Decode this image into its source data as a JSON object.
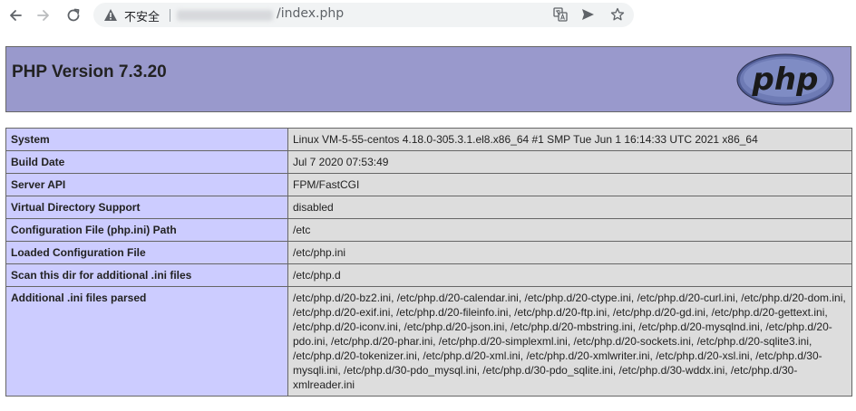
{
  "browser": {
    "security_label": "不安全",
    "url_path": "/index.php"
  },
  "header": {
    "title": "PHP Version 7.3.20",
    "logo_text": "php"
  },
  "info_rows": [
    {
      "key": "System",
      "value": "Linux VM-5-55-centos 4.18.0-305.3.1.el8.x86_64 #1 SMP Tue Jun 1 16:14:33 UTC 2021 x86_64"
    },
    {
      "key": "Build Date",
      "value": "Jul 7 2020 07:53:49"
    },
    {
      "key": "Server API",
      "value": "FPM/FastCGI"
    },
    {
      "key": "Virtual Directory Support",
      "value": "disabled"
    },
    {
      "key": "Configuration File (php.ini) Path",
      "value": "/etc"
    },
    {
      "key": "Loaded Configuration File",
      "value": "/etc/php.ini"
    },
    {
      "key": "Scan this dir for additional .ini files",
      "value": "/etc/php.d"
    },
    {
      "key": "Additional .ini files parsed",
      "value": "/etc/php.d/20-bz2.ini, /etc/php.d/20-calendar.ini, /etc/php.d/20-ctype.ini, /etc/php.d/20-curl.ini, /etc/php.d/20-dom.ini, /etc/php.d/20-exif.ini, /etc/php.d/20-fileinfo.ini, /etc/php.d/20-ftp.ini, /etc/php.d/20-gd.ini, /etc/php.d/20-gettext.ini, /etc/php.d/20-iconv.ini, /etc/php.d/20-json.ini, /etc/php.d/20-mbstring.ini, /etc/php.d/20-mysqlnd.ini, /etc/php.d/20-pdo.ini, /etc/php.d/20-phar.ini, /etc/php.d/20-simplexml.ini, /etc/php.d/20-sockets.ini, /etc/php.d/20-sqlite3.ini, /etc/php.d/20-tokenizer.ini, /etc/php.d/20-xml.ini, /etc/php.d/20-xmlwriter.ini, /etc/php.d/20-xsl.ini, /etc/php.d/30-mysqli.ini, /etc/php.d/30-pdo_mysql.ini, /etc/php.d/30-pdo_sqlite.ini, /etc/php.d/30-wddx.ini, /etc/php.d/30-xmlreader.ini"
    }
  ],
  "colors": {
    "header_bg": "#9999cc",
    "key_bg": "#ccccff",
    "value_bg": "#dddddd",
    "border": "#666666"
  },
  "icons": {
    "back": "arrow-left-icon",
    "forward": "arrow-right-icon",
    "reload": "reload-icon",
    "security": "warning-triangle-icon",
    "translate": "translate-icon",
    "send": "send-icon",
    "bookmark": "star-icon"
  }
}
